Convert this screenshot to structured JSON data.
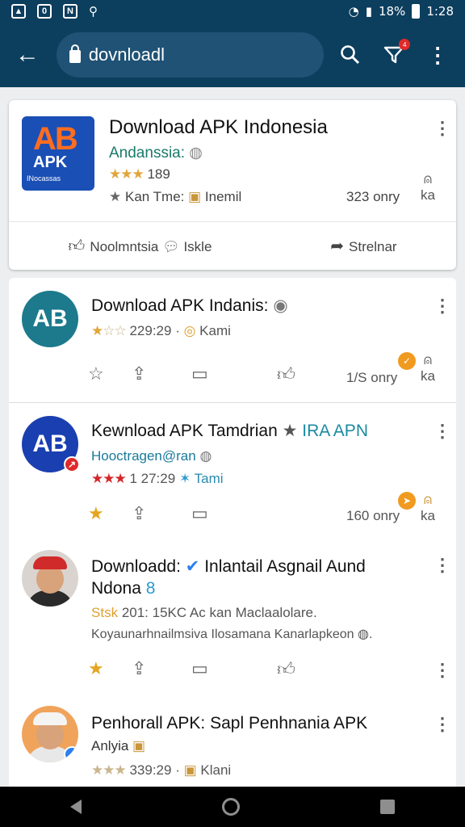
{
  "status": {
    "time": "1:28",
    "battery": "18%"
  },
  "search": {
    "query": "dovnloadl"
  },
  "badge": {
    "count": "4"
  },
  "featured": {
    "title": "Download APK Indonesia",
    "subtitle": "Andanssia:",
    "rating_text": "189",
    "meta": "Kan Tme:",
    "meta2": "Inemil",
    "size": "323 onry",
    "side_label": "ka",
    "icon": {
      "letters": "AB",
      "name": "APK",
      "sub": "INocassas"
    },
    "actions": [
      "Noolmntsia",
      "Iskle",
      "Strelnar"
    ]
  },
  "items": [
    {
      "title": "Download APK Indanis:",
      "meta": "229:29 ·",
      "meta2": "Kami",
      "size": "1/S onry",
      "side": "ka"
    },
    {
      "title": "Kewnload APK Tamdrian",
      "title_extra": "IRA APN",
      "sub": "Hooctragen@ran",
      "meta": "1 27:29",
      "meta2": "Tami",
      "size": "160 onry",
      "side": "ka"
    },
    {
      "title": "Downloadd:",
      "title_rest": "Inlantail Asgnail Aund",
      "title_line2": "Ndona",
      "desc1": "201: 15KC Ac kan Maclaalolare.",
      "desc1_prefix": "S",
      "desc2": "Koyaunarhnailmsiva Ilosamana Kanarlapkeon"
    },
    {
      "title": "Penhorall APK: Sapl Penhnania APK",
      "sub": "Anlyia",
      "meta": "339:29 ·",
      "meta2": "Klani"
    }
  ]
}
